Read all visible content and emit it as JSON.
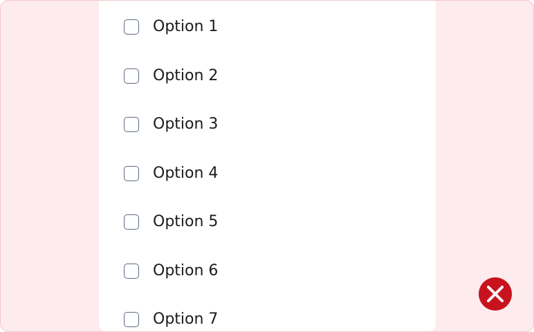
{
  "options": [
    {
      "label": "Option 1",
      "checked": false
    },
    {
      "label": "Option 2",
      "checked": false
    },
    {
      "label": "Option 3",
      "checked": false
    },
    {
      "label": "Option 4",
      "checked": false
    },
    {
      "label": "Option 5",
      "checked": false
    },
    {
      "label": "Option 6",
      "checked": false
    },
    {
      "label": "Option 7",
      "checked": false
    }
  ],
  "close_button": {
    "icon": "close-icon",
    "color": "#c8131f"
  },
  "colors": {
    "backdrop": "#fdebed",
    "panel": "#ffffff",
    "checkbox_border": "#5b6b84"
  }
}
